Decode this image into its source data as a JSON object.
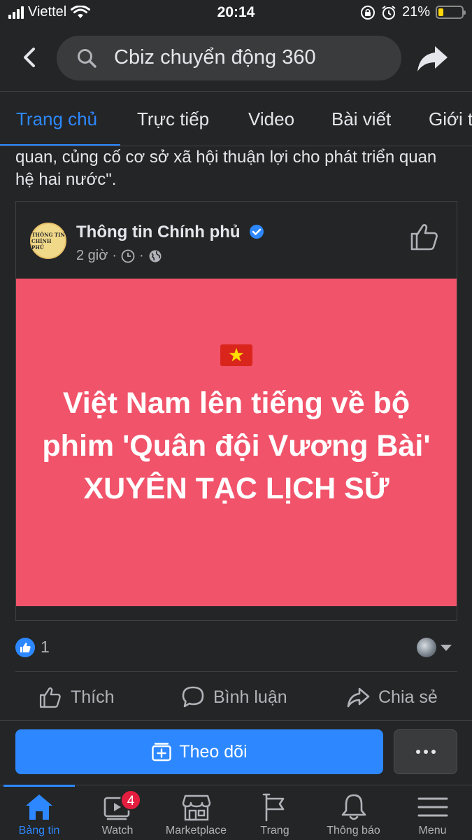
{
  "status_bar": {
    "carrier": "Viettel",
    "time": "20:14",
    "battery_percent": "21%",
    "battery_level": 0.21
  },
  "search": {
    "query": "Cbiz chuyển động 360"
  },
  "tabs": [
    {
      "label": "Trang chủ",
      "active": true
    },
    {
      "label": "Trực tiếp"
    },
    {
      "label": "Video"
    },
    {
      "label": "Bài viết"
    },
    {
      "label": "Giới t"
    }
  ],
  "post": {
    "body_text": "quan, củng cố cơ sở xã hội thuận lợi cho phát triển quan hệ hai nước\".",
    "shared": {
      "page_name": "Thông tin Chính phủ",
      "avatar_text_line1": "THÔNG TIN",
      "avatar_text_line2": "CHÍNH PHỦ",
      "time": "2 giờ",
      "banner_text": "Việt Nam lên tiếng về bộ phim 'Quân đội Vương Bài' XUYÊN TẠC LỊCH SỬ",
      "banner_color": "#f1536a"
    },
    "reaction_count": "1",
    "actions": {
      "like": "Thích",
      "comment": "Bình luận",
      "share": "Chia sẻ"
    }
  },
  "follow_button": "Theo dõi",
  "bottom_nav": [
    {
      "label": "Bảng tin",
      "icon": "home-icon",
      "active": true
    },
    {
      "label": "Watch",
      "icon": "watch-icon",
      "badge": "4"
    },
    {
      "label": "Marketplace",
      "icon": "marketplace-icon"
    },
    {
      "label": "Trang",
      "icon": "flag-icon"
    },
    {
      "label": "Thông báo",
      "icon": "bell-icon"
    },
    {
      "label": "Menu",
      "icon": "menu-icon"
    }
  ],
  "colors": {
    "accent": "#2d88ff",
    "background": "#242526",
    "badge": "#e41e3f"
  }
}
